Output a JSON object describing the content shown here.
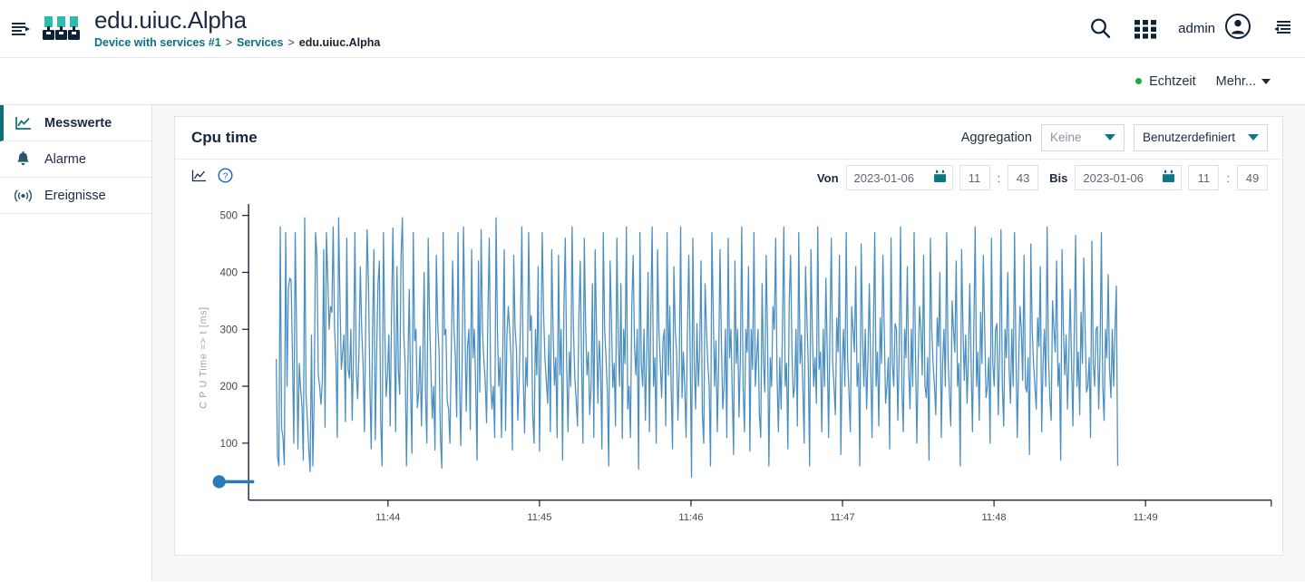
{
  "header": {
    "menu_icon": "sidebar-collapse-icon",
    "logo_icon": "devices-logo-icon",
    "app_title": "edu.uiuc.Alpha",
    "breadcrumb": {
      "root": "Device with services #1",
      "sep1": ">",
      "section": "Services",
      "sep2": ">",
      "current": "edu.uiuc.Alpha"
    },
    "search_icon": "search-icon",
    "apps_icon": "app-grid-icon",
    "user_name": "admin",
    "avatar_icon": "user-avatar-icon",
    "right_panel_icon": "right-panel-toggle-icon"
  },
  "subbar": {
    "realtime_label": "Echtzeit",
    "realtime_dot_color": "#21a63b",
    "more_label": "Mehr...",
    "more_caret_icon": "chevron-down-icon"
  },
  "sidebar": {
    "items": [
      {
        "label": "Messwerte",
        "icon": "line-chart-icon",
        "active": true
      },
      {
        "label": "Alarme",
        "icon": "bell-icon",
        "active": false
      },
      {
        "label": "Ereignisse",
        "icon": "broadcast-icon",
        "active": false
      }
    ]
  },
  "card": {
    "title": "Cpu time",
    "aggregation_label": "Aggregation",
    "aggregation_value": "Keine",
    "aggregation_caret_icon": "chevron-down-icon",
    "range_preset_value": "Benutzerdefiniert",
    "range_preset_caret_icon": "chevron-down-icon",
    "chart_toggle_icon": "line-chart-icon",
    "help_icon": "help-circle-icon",
    "range": {
      "from_label": "Von",
      "from_date": "2023-01-06",
      "from_hour": "11",
      "from_separator": ":",
      "from_minute": "43",
      "from_calendar_icon": "calendar-icon",
      "to_label": "Bis",
      "to_date": "2023-01-06",
      "to_hour": "11",
      "to_separator": ":",
      "to_minute": "49",
      "to_calendar_icon": "calendar-icon"
    }
  },
  "chart_data": {
    "type": "line",
    "title": "Cpu time",
    "xlabel": "",
    "ylabel": "C P U Time => t [ms]",
    "ylim": [
      0,
      520
    ],
    "y_ticks": [
      100,
      200,
      300,
      400,
      500
    ],
    "x_ticks": [
      "11:44",
      "11:45",
      "11:46",
      "11:47",
      "11:48",
      "11:49"
    ],
    "grid": false,
    "legend": "none",
    "line_color": "#4a8fc2",
    "x_range_start": "11:43",
    "x_range_end": "11:49",
    "series": [
      {
        "name": "Cpu time",
        "values": [
          248,
          76,
          60,
          480,
          126,
          110,
          62,
          470,
          200,
          372,
          390,
          386,
          250,
          100,
          470,
          300,
          90,
          240,
          196,
          166,
          70,
          496,
          184,
          140,
          90,
          50,
          290,
          60,
          180,
          470,
          430,
          220,
          200,
          168,
          210,
          440,
          128,
          470,
          390,
          300,
          340,
          330,
          480,
          300,
          250,
          110,
          496,
          350,
          230,
          260,
          290,
          138,
          460,
          230,
          214,
          300,
          140,
          260,
          470,
          226,
          178,
          260,
          410,
          300,
          240,
          120,
          320,
          475,
          380,
          204,
          90,
          300,
          440,
          106,
          256,
          380,
          420,
          140,
          60,
          470,
          300,
          182,
          220,
          290,
          130,
          330,
          478,
          300,
          120,
          410,
          230,
          186,
          430,
          496,
          290,
          240,
          60,
          230,
          370,
          200,
          82,
          470,
          280,
          300,
          162,
          190,
          270,
          130,
          240,
          400,
          188,
          100,
          460,
          320,
          230,
          144,
          200,
          88,
          430,
          310,
          260,
          110,
          56,
          470,
          290,
          300,
          174,
          160,
          100,
          260,
          420,
          300,
          252,
          146,
          470,
          220,
          96,
          240,
          480,
          320,
          156,
          270,
          300,
          124,
          440,
          250,
          300,
          200,
          70,
          420,
          190,
          475,
          298,
          246,
          210,
          136,
          330,
          460,
          210,
          160,
          200,
          110,
          496,
          300,
          200,
          250,
          110,
          270,
          440,
          122,
          290,
          340,
          300,
          250,
          88,
          430,
          302,
          266,
          140,
          210,
          310,
          480,
          220,
          118,
          250,
          200,
          470,
          298,
          324,
          150,
          100,
          300,
          220,
          410,
          86,
          260,
          470,
          330,
          250,
          210,
          170,
          290,
          120,
          440,
          300,
          202,
          250,
          110,
          430,
          220,
          300,
          70,
          340,
          460,
          240,
          120,
          260,
          200,
          480,
          300,
          216,
          176,
          130,
          320,
          420,
          240,
          100,
          460,
          306,
          220,
          260,
          150,
          200,
          380,
          110,
          440,
          300,
          170,
          280,
          230,
          90,
          470,
          300,
          250,
          190,
          60,
          420,
          320,
          198,
          240,
          130,
          460,
          280,
          200,
          380,
          108,
          300,
          240,
          480,
          160,
          200,
          110,
          340,
          430,
          270,
          220,
          300,
          54,
          470,
          240,
          200,
          300,
          140,
          260,
          400,
          120,
          320,
          480,
          200,
          250,
          100,
          440,
          298,
          240,
          180,
          280,
          300,
          130,
          470,
          220,
          340,
          200,
          90,
          410,
          300,
          260,
          140,
          240,
          480,
          180,
          260,
          200,
          110,
          300,
          430,
          260,
          40,
          460,
          240,
          160,
          310,
          200,
          260,
          420,
          150,
          100,
          380,
          300,
          240,
          200,
          60,
          470,
          330,
          200,
          280,
          120,
          240,
          440,
          280,
          160,
          200,
          300,
          110,
          460,
          250,
          300,
          190,
          80,
          420,
          240,
          300,
          146,
          250,
          480,
          200,
          120,
          300,
          260,
          410,
          86,
          300,
          230,
          470,
          200,
          250,
          300,
          150,
          110,
          380,
          240,
          190,
          430,
          290,
          60,
          250,
          200,
          340,
          300,
          460,
          220,
          120,
          250,
          160,
          300,
          480,
          200,
          240,
          90,
          350,
          430,
          260,
          180,
          200,
          300,
          130,
          470,
          240,
          290,
          200,
          100,
          410,
          320,
          240,
          60,
          440,
          300,
          200,
          250,
          170,
          480,
          230,
          260,
          120,
          300,
          200,
          390,
          260,
          110,
          300,
          460,
          240,
          200,
          150,
          320,
          260,
          430,
          80,
          240,
          300,
          200,
          470,
          250,
          190,
          120,
          340,
          300,
          260,
          410,
          200,
          240,
          60,
          450,
          290,
          200,
          300,
          160,
          250,
          380,
          240,
          110,
          300,
          470,
          200,
          260,
          130,
          320,
          240,
          430,
          300,
          170,
          200,
          250,
          90,
          460,
          240,
          200,
          310,
          300,
          140,
          260,
          480,
          200,
          120,
          300,
          250,
          410,
          230,
          160,
          300,
          200,
          470,
          260,
          100,
          240,
          340,
          300,
          220,
          430,
          200,
          180,
          250,
          70,
          460,
          300,
          240,
          200,
          150,
          320,
          270,
          400,
          110,
          240,
          300,
          200,
          470,
          250,
          190,
          130,
          350,
          300,
          260,
          420,
          200,
          240,
          60,
          440,
          300,
          210,
          290,
          170,
          250,
          380,
          240,
          120,
          300,
          480,
          200,
          260,
          140,
          330,
          240,
          430,
          300,
          180,
          200,
          250,
          100,
          460,
          240,
          200,
          300,
          310,
          150,
          260,
          475,
          200,
          130,
          300,
          250,
          400,
          230,
          170,
          300,
          200,
          470,
          260,
          110,
          240,
          340,
          300,
          210,
          430,
          200,
          190,
          250,
          80,
          450,
          300,
          240,
          200,
          160,
          320,
          270,
          410,
          120,
          240,
          300,
          200,
          480,
          250,
          180,
          140,
          350,
          300,
          260,
          420,
          200,
          240,
          70,
          440,
          300,
          220,
          290,
          160,
          250,
          370,
          240,
          130,
          300,
          465,
          200,
          260,
          150,
          330,
          240,
          425,
          300,
          190,
          200,
          250,
          110,
          455,
          240,
          200,
          300,
          305,
          160,
          260,
          470,
          200,
          140,
          300,
          250,
          396,
          230,
          180,
          300,
          200,
          300,
          376,
          60
        ]
      }
    ]
  },
  "slider": {
    "name": "y-axis-range-slider",
    "handle_color": "#2a7ab9"
  }
}
